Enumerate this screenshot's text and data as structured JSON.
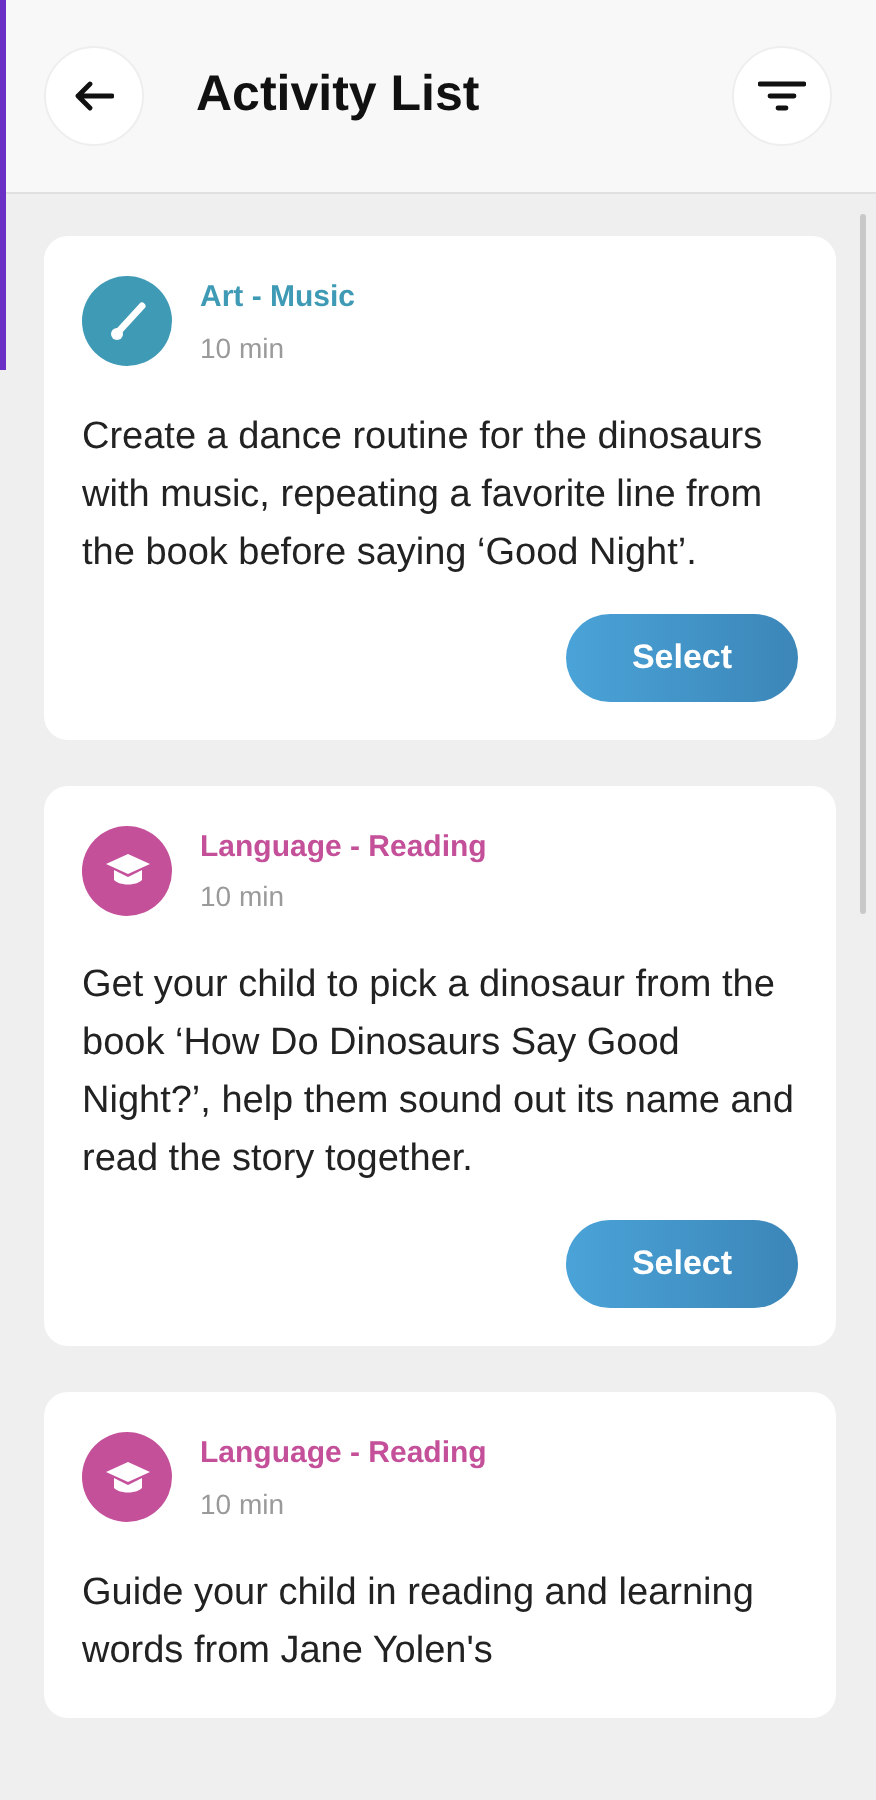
{
  "header": {
    "title": "Activity List"
  },
  "activities": [
    {
      "kind": "art",
      "category": "Art - Music",
      "color": "#3f9ab5",
      "duration": "10 min",
      "description": "Create a dance routine for the dinosaurs with music, repeating a favorite line from the book before saying ‘Good Night’.",
      "button": "Select"
    },
    {
      "kind": "language",
      "category": "Language - Reading",
      "color": "#c4509a",
      "duration": "10 min",
      "description": "Get your child to pick a dinosaur from the book ‘How Do Dinosaurs Say Good Night?’, help them sound out its name and read the story together.",
      "button": "Select"
    },
    {
      "kind": "language",
      "category": "Language - Reading",
      "color": "#c4509a",
      "duration": "10 min",
      "description": "Guide your child in reading and learning words from Jane Yolen's"
    }
  ]
}
